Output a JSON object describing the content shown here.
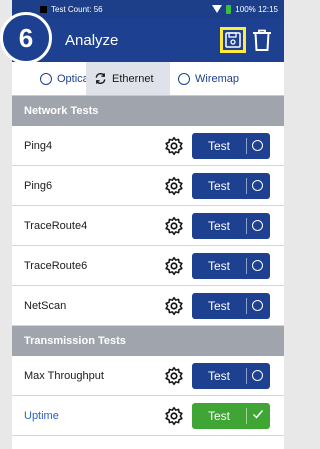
{
  "step_badge": "6",
  "status_bar": {
    "test_count": "Test Count: 56",
    "battery_time": "100% 12:15"
  },
  "app_bar": {
    "title": "Analyze"
  },
  "tabs": [
    {
      "label": "Optical",
      "selected": false
    },
    {
      "label": "Ethernet",
      "selected": true
    },
    {
      "label": "Wiremap",
      "selected": false
    }
  ],
  "sections": [
    {
      "title": "Network Tests",
      "tests": [
        {
          "name": "Ping4",
          "button": "Test",
          "status": "idle"
        },
        {
          "name": "Ping6",
          "button": "Test",
          "status": "idle"
        },
        {
          "name": "TraceRoute4",
          "button": "Test",
          "status": "idle"
        },
        {
          "name": "TraceRoute6",
          "button": "Test",
          "status": "idle"
        },
        {
          "name": "NetScan",
          "button": "Test",
          "status": "idle"
        }
      ]
    },
    {
      "title": "Transmission Tests",
      "tests": [
        {
          "name": "Max Throughput",
          "button": "Test",
          "status": "idle"
        },
        {
          "name": "Uptime",
          "button": "Test",
          "status": "passed"
        }
      ]
    }
  ],
  "colors": {
    "primary": "#1d4090",
    "pass": "#3fa534",
    "highlight": "#ffeb3b",
    "section": "#a0a5ad"
  }
}
